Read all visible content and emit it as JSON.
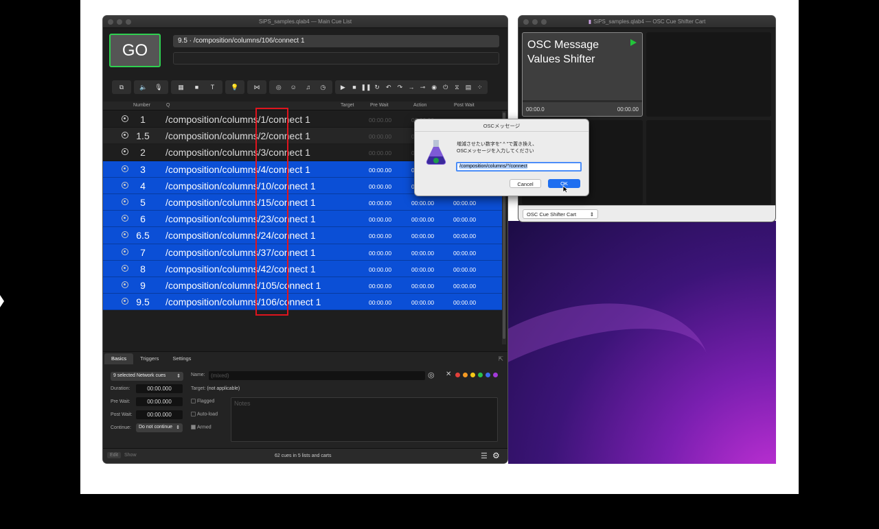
{
  "main_window": {
    "title": "SiPS_samples.qlab4 — Main Cue List",
    "go_label": "GO",
    "current_cue": "9.5 · /composition/columns/106/connect 1"
  },
  "columns": {
    "number": "Number",
    "q": "Q",
    "target": "Target",
    "pre_wait": "Pre Wait",
    "action": "Action",
    "post_wait": "Post Wait"
  },
  "cues": [
    {
      "number": "1",
      "q": "/composition/columns/1/connect 1",
      "pre": "00:00.00",
      "act": "00:00.00",
      "post": "",
      "state": "dim"
    },
    {
      "number": "1.5",
      "q": "/composition/columns/2/connect 1",
      "pre": "00:00.00",
      "act": "00:00.00",
      "post": "",
      "state": "alt"
    },
    {
      "number": "2",
      "q": "/composition/columns/3/connect 1",
      "pre": "00:00.00",
      "act": "00:00.00",
      "post": "",
      "state": "dim"
    },
    {
      "number": "3",
      "q": "/composition/columns/4/connect 1",
      "pre": "00:00.00",
      "act": "00:00.00",
      "post": "",
      "state": "sel"
    },
    {
      "number": "4",
      "q": "/composition/columns/10/connect 1",
      "pre": "00:00.00",
      "act": "00:00.00",
      "post": "",
      "state": "sel"
    },
    {
      "number": "5",
      "q": "/composition/columns/15/connect 1",
      "pre": "00:00.00",
      "act": "00:00.00",
      "post": "00:00.00",
      "state": "sel"
    },
    {
      "number": "6",
      "q": "/composition/columns/23/connect 1",
      "pre": "00:00.00",
      "act": "00:00.00",
      "post": "00:00.00",
      "state": "sel"
    },
    {
      "number": "6.5",
      "q": "/composition/columns/24/connect 1",
      "pre": "00:00.00",
      "act": "00:00.00",
      "post": "00:00.00",
      "state": "sel"
    },
    {
      "number": "7",
      "q": "/composition/columns/37/connect 1",
      "pre": "00:00.00",
      "act": "00:00.00",
      "post": "00:00.00",
      "state": "sel"
    },
    {
      "number": "8",
      "q": "/composition/columns/42/connect 1",
      "pre": "00:00.00",
      "act": "00:00.00",
      "post": "00:00.00",
      "state": "sel"
    },
    {
      "number": "9",
      "q": "/composition/columns/105/connect 1",
      "pre": "00:00.00",
      "act": "00:00.00",
      "post": "00:00.00",
      "state": "sel"
    },
    {
      "number": "9.5",
      "q": "/composition/columns/106/connect 1",
      "pre": "00:00.00",
      "act": "00:00.00",
      "post": "00:00.00",
      "state": "sel"
    }
  ],
  "inspector": {
    "tabs": [
      "Basics",
      "Triggers",
      "Settings"
    ],
    "selector": "9 selected Network cues",
    "name_label": "Name:",
    "name_placeholder": "(mixed)",
    "duration_label": "Duration:",
    "duration": "00:00.000",
    "target_label": "Target:",
    "target_value": "(not applicable)",
    "prewait_label": "Pre Wait:",
    "prewait": "00:00.000",
    "flagged": "Flagged",
    "postwait_label": "Post Wait:",
    "postwait": "00:00.000",
    "autoload": "Auto-load",
    "continue_label": "Continue:",
    "continue_value": "Do not continue",
    "armed": "Armed",
    "notes_placeholder": "Notes",
    "color_dots": [
      "#e2403a",
      "#f59a23",
      "#f5c816",
      "#2ac14b",
      "#3b6cf0",
      "#a33ad9"
    ]
  },
  "status": {
    "edit": "Edit",
    "show": "Show",
    "count": "62 cues in 5 lists and carts"
  },
  "cart_window": {
    "title": "SiPS_samples.qlab4 — OSC Cue Shifter Cart",
    "tile_name": "OSC Message Values Shifter",
    "tile_time_left": "00:00.0",
    "tile_time_right": "00:00.00",
    "selector": "OSC Cue Shifter Cart"
  },
  "dialog": {
    "title": "OSCメッセージ",
    "line1": "増減させたい数字を\" ^ \"で置き換え、",
    "line2": "OSCメッセージを入力してください",
    "input": "/composition/columns/^/connect",
    "cancel": "Cancel",
    "ok": "OK"
  }
}
